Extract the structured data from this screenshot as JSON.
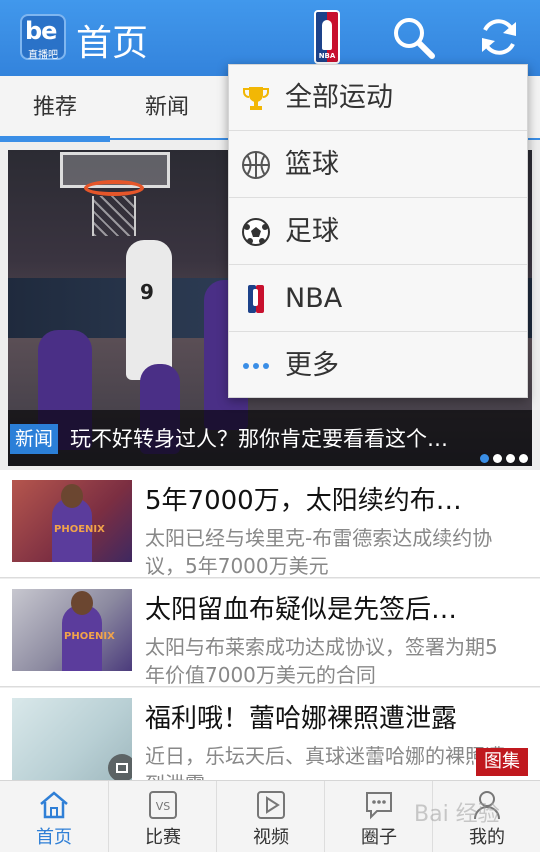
{
  "header": {
    "logo_text": "be",
    "logo_subtext": "直播吧",
    "title": "首页",
    "nba_logo_text": "NBA",
    "icons": [
      "search-icon",
      "refresh-icon"
    ]
  },
  "tabs": [
    {
      "label": "推荐",
      "active": true
    },
    {
      "label": "新闻",
      "active": false
    }
  ],
  "hero": {
    "tag": "新闻",
    "caption": "玩不好转身过人？那你肯定要看看这个…",
    "jersey_number": "9",
    "dots_total": 4,
    "dots_active": 1
  },
  "news": [
    {
      "headline": "5年7000万，太阳续约布…",
      "summary": "太阳已经与埃里克-布雷德索达成续约协议，5年7000万美元",
      "thumb_jersey": "PHOENIX"
    },
    {
      "headline": "太阳留血布疑似是先签后…",
      "summary": "太阳与布莱索成功达成协议，签署为期5年价值7000万美元的合同",
      "thumb_jersey": "PHOENIX"
    },
    {
      "headline": "福利哦！蕾哈娜裸照遭泄露",
      "summary": "近日，乐坛天后、真球迷蕾哈娜的裸照遭到泄露",
      "badge": "图集"
    }
  ],
  "dropdown": {
    "items": [
      {
        "label": "全部运动",
        "icon": "trophy-icon"
      },
      {
        "label": "篮球",
        "icon": "basketball-icon"
      },
      {
        "label": "足球",
        "icon": "soccer-ball-icon"
      },
      {
        "label": "NBA",
        "icon": "nba-logo-icon"
      },
      {
        "label": "更多",
        "icon": "more-dots-icon"
      }
    ]
  },
  "bottom_nav": [
    {
      "label": "首页",
      "icon": "home-icon",
      "active": true
    },
    {
      "label": "比赛",
      "icon": "vs-icon",
      "icon_text": "VS",
      "active": false
    },
    {
      "label": "视频",
      "icon": "play-icon",
      "active": false
    },
    {
      "label": "圈子",
      "icon": "chat-icon",
      "active": false
    },
    {
      "label": "我的",
      "icon": "user-icon",
      "active": false
    }
  ],
  "watermark": "Bai 经验",
  "colors": {
    "brand_blue": "#3a8ee6",
    "header_blue": "#3383dc",
    "album_red": "#c0181e",
    "trophy_gold": "#f2b705"
  }
}
